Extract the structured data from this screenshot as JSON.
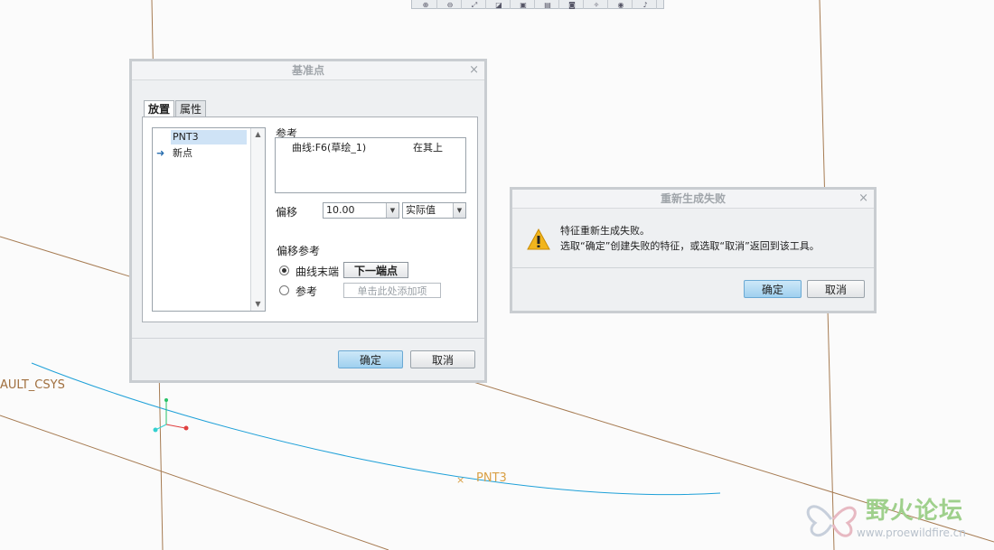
{
  "canvas": {
    "csys_label": "AULT_CSYS",
    "point_label": "PNT3",
    "colors": {
      "datum_line": "#a67b52",
      "curve": "#1ea0d8",
      "point_label": "#d9a045"
    }
  },
  "toolbar": {
    "icons": [
      "zoom-in-icon",
      "zoom-out-icon",
      "refit-icon",
      "repaint-icon",
      "view-icon",
      "saved-views-icon",
      "camera-icon",
      "sketch-display-icon",
      "eye-icon",
      "spin-center-icon"
    ],
    "glyphs": [
      "⊕",
      "⊖",
      "⤢",
      "◪",
      "▣",
      "▤",
      "◙",
      "✧",
      "◉",
      "♪"
    ]
  },
  "datum_point_dialog": {
    "title": "基准点",
    "close": "×",
    "tabs": [
      {
        "label": "放置",
        "active": true
      },
      {
        "label": "属性",
        "active": false
      }
    ],
    "points_list": {
      "items": [
        {
          "label": "PNT3",
          "selected": true
        },
        {
          "label": "新点",
          "selected": false,
          "marker": "➜"
        }
      ]
    },
    "reference": {
      "label": "参考",
      "entry": {
        "name": "曲线:F6(草绘_1)",
        "constraint": "在其上"
      }
    },
    "offset": {
      "label": "偏移",
      "value": "10.00",
      "type": "实际值"
    },
    "offset_reference": {
      "label": "偏移参考",
      "options": [
        {
          "label": "曲线末端",
          "selected": true,
          "button": "下一端点"
        },
        {
          "label": "参考",
          "selected": false,
          "placeholder": "单击此处添加项"
        }
      ]
    },
    "ok": "确定",
    "cancel": "取消"
  },
  "regen_failure_dialog": {
    "title": "重新生成失败",
    "close": "×",
    "line1": "特征重新生成失败。",
    "line2": "选取“确定”创建失败的特征，或选取“取消”返回到该工具。",
    "ok": "确定",
    "cancel": "取消",
    "colors": {
      "warning": "#f2b51c"
    }
  },
  "watermark": {
    "text": "野火论坛",
    "url": "www.proewildfire.cn"
  }
}
